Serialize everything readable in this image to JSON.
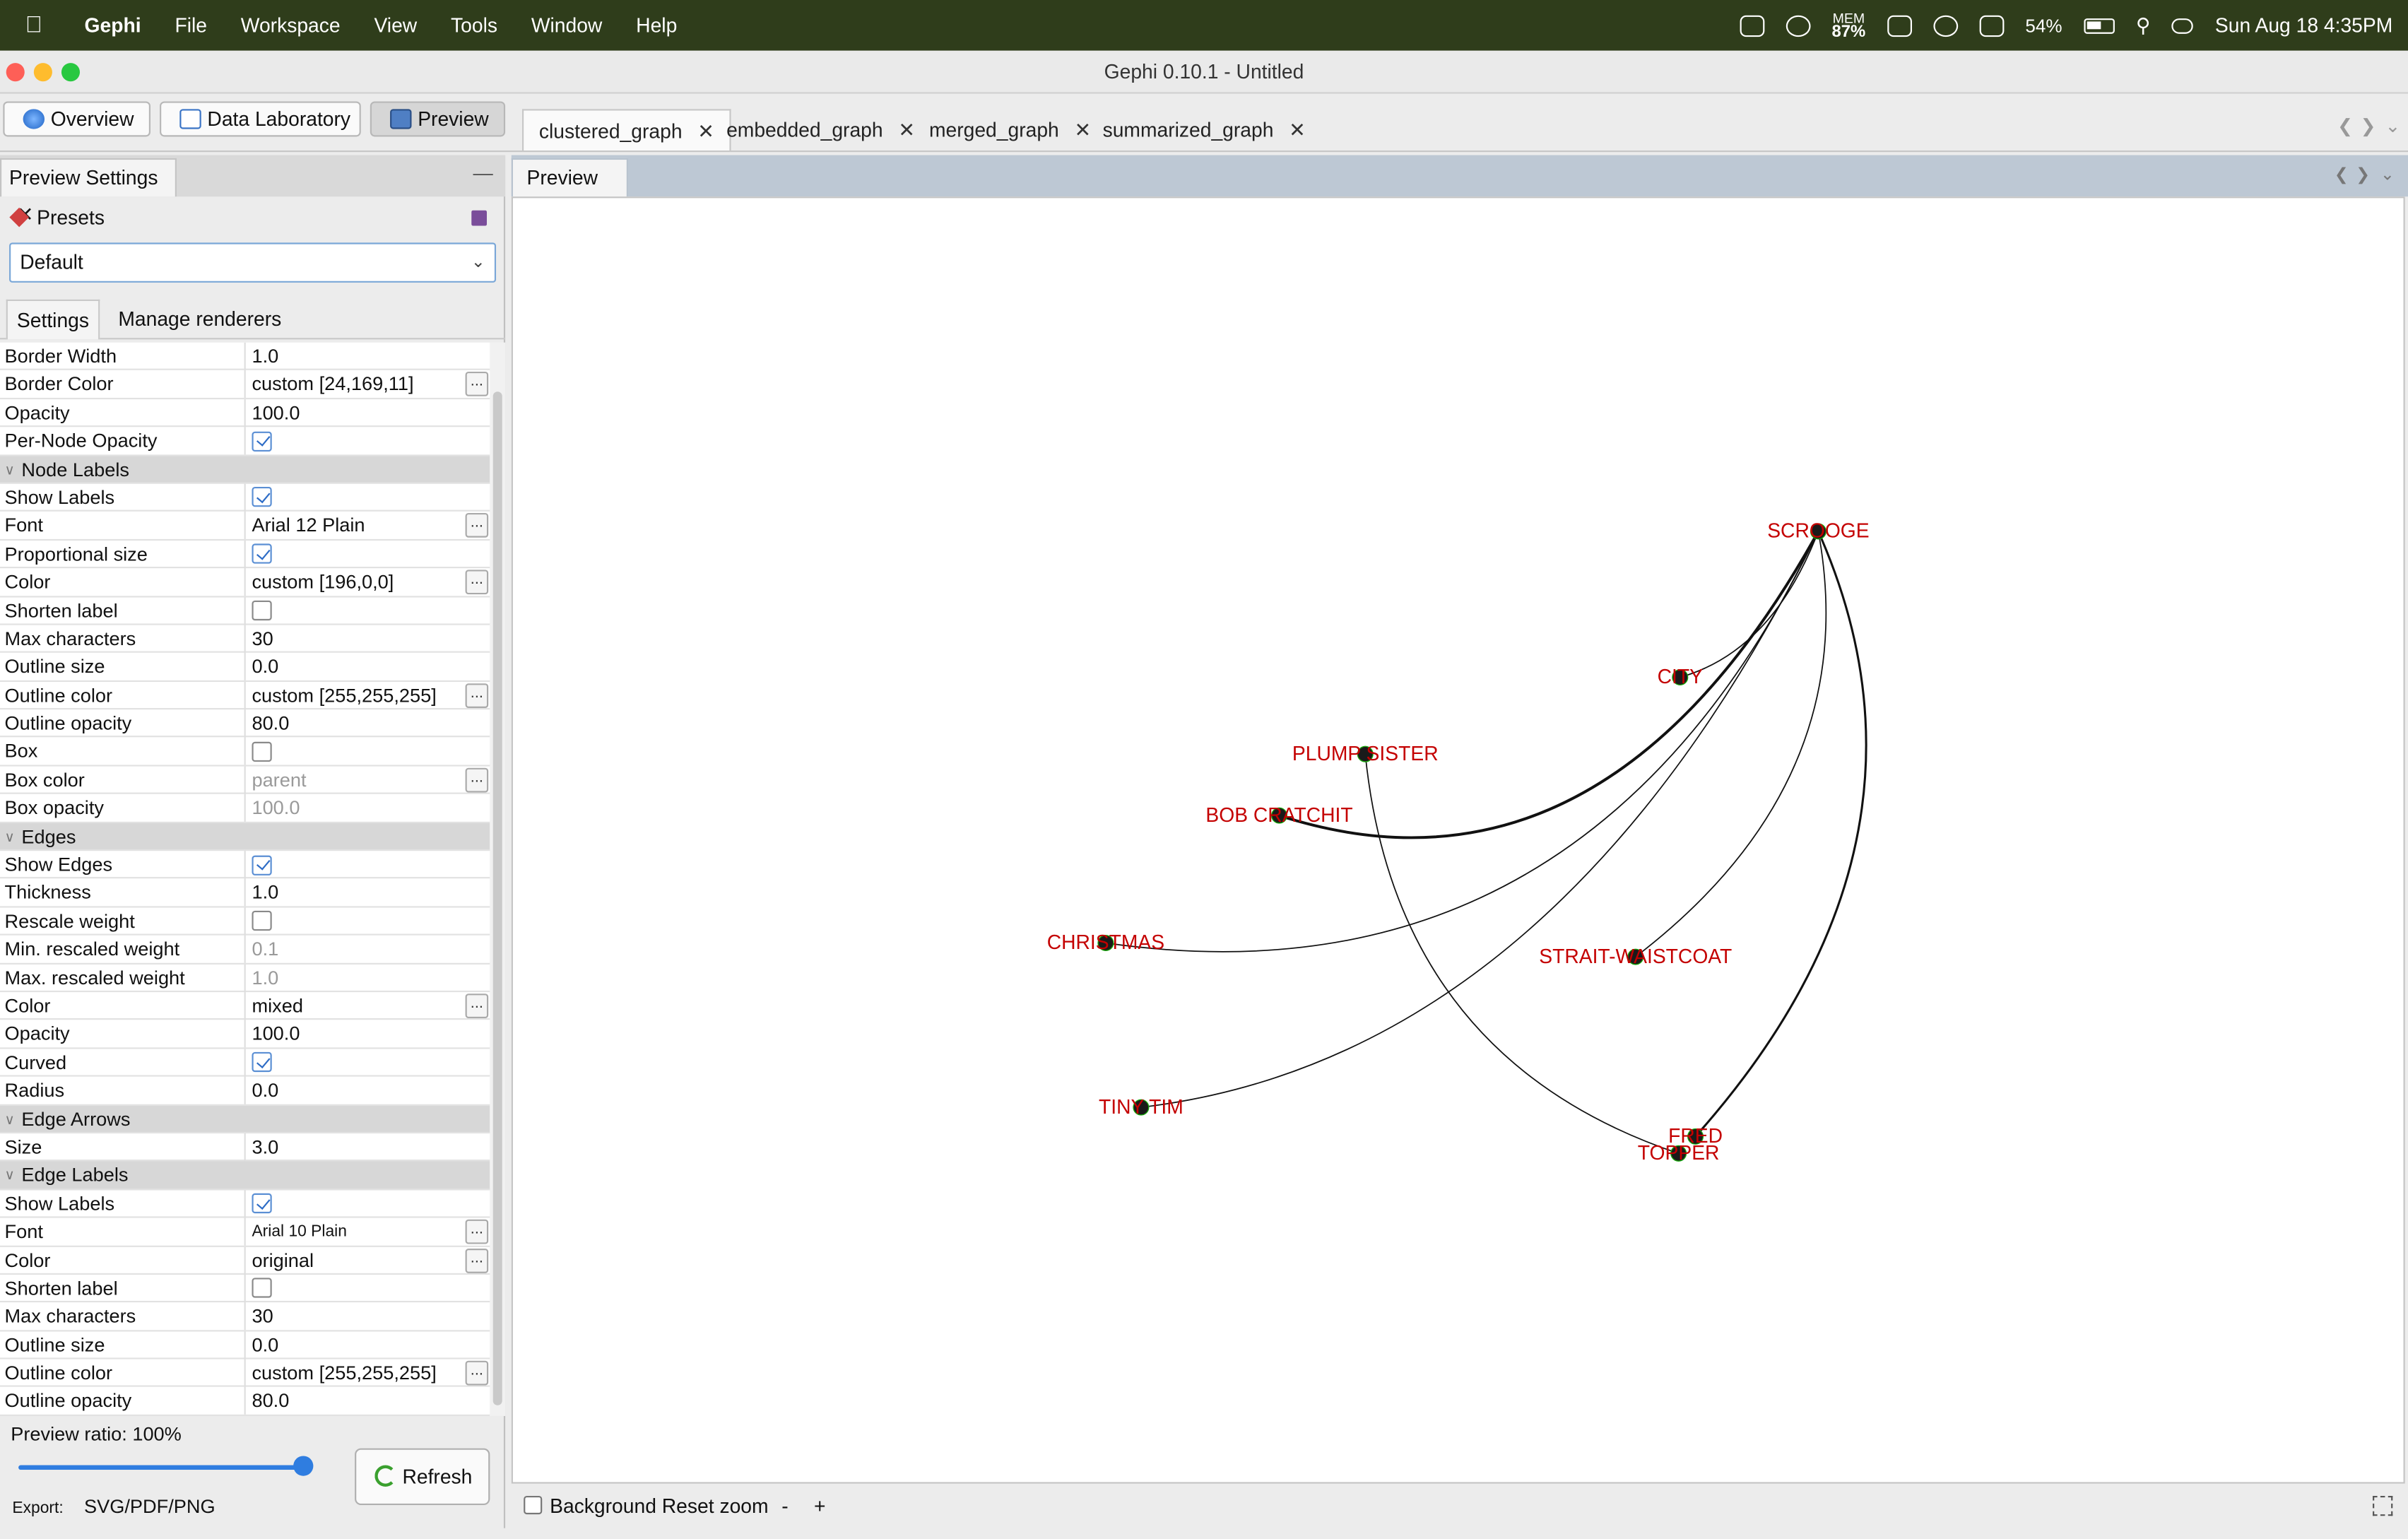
{
  "menubar": {
    "app": "Gephi",
    "items": [
      "File",
      "Workspace",
      "View",
      "Tools",
      "Window",
      "Help"
    ],
    "mem_label": "MEM",
    "mem_value": "87%",
    "battery": "54%",
    "clock": "Sun Aug 18  4:35PM"
  },
  "window": {
    "title": "Gephi 0.10.1 - Untitled"
  },
  "modes": [
    "Overview",
    "Data Laboratory",
    "Preview"
  ],
  "doc_tabs": [
    "clustered_graph",
    "embedded_graph",
    "merged_graph",
    "summarized_graph"
  ],
  "left_panel": {
    "tab": "Preview Settings",
    "presets_label": "Presets",
    "preset_value": "Default",
    "subtabs": [
      "Settings",
      "Manage renderers"
    ],
    "rows": [
      {
        "name": "Border Width",
        "value": "1.0"
      },
      {
        "name": "Border Color",
        "value": "custom [24,169,11]",
        "ell": true
      },
      {
        "name": "Opacity",
        "value": "100.0"
      },
      {
        "name": "Per-Node Opacity",
        "check": true
      },
      {
        "section": "Node Labels"
      },
      {
        "name": "Show Labels",
        "check": true
      },
      {
        "name": "Font",
        "value": "Arial 12 Plain",
        "ell": true
      },
      {
        "name": "Proportional size",
        "check": true
      },
      {
        "name": "Color",
        "value": "custom [196,0,0]",
        "ell": true
      },
      {
        "name": "Shorten label",
        "check": false
      },
      {
        "name": "Max characters",
        "value": "30"
      },
      {
        "name": "Outline size",
        "value": "0.0"
      },
      {
        "name": "Outline color",
        "value": "custom [255,255,255]",
        "ell": true
      },
      {
        "name": "Outline opacity",
        "value": "80.0"
      },
      {
        "name": "Box",
        "check": false
      },
      {
        "name": "Box color",
        "value": "parent",
        "ell": true,
        "dim": true
      },
      {
        "name": "Box opacity",
        "value": "100.0",
        "dim": true
      },
      {
        "section": "Edges"
      },
      {
        "name": "Show Edges",
        "check": true
      },
      {
        "name": "Thickness",
        "value": "1.0"
      },
      {
        "name": "Rescale weight",
        "check": false
      },
      {
        "name": "Min. rescaled weight",
        "value": "0.1",
        "dim": true
      },
      {
        "name": "Max. rescaled weight",
        "value": "1.0",
        "dim": true
      },
      {
        "name": "Color",
        "value": "mixed",
        "ell": true
      },
      {
        "name": "Opacity",
        "value": "100.0"
      },
      {
        "name": "Curved",
        "check": true
      },
      {
        "name": "Radius",
        "value": "0.0"
      },
      {
        "section": "Edge Arrows"
      },
      {
        "name": "Size",
        "value": "3.0"
      },
      {
        "section": "Edge Labels"
      },
      {
        "name": "Show Labels",
        "check": true
      },
      {
        "name": "Font",
        "value": "Arial 10 Plain",
        "ell": true,
        "small": true
      },
      {
        "name": "Color",
        "value": "original",
        "ell": true
      },
      {
        "name": "Shorten label",
        "check": false
      },
      {
        "name": "Max characters",
        "value": "30"
      },
      {
        "name": "Outline size",
        "value": "0.0"
      },
      {
        "name": "Outline color",
        "value": "custom [255,255,255]",
        "ell": true
      },
      {
        "name": "Outline opacity",
        "value": "80.0"
      }
    ],
    "preview_ratio": "Preview ratio: 100%",
    "preview_ratio_value": 1.0,
    "refresh_label": "Refresh",
    "export_label": "Export:",
    "export_formats": "SVG/PDF/PNG"
  },
  "preview": {
    "tab": "Preview",
    "background_label": "Background",
    "reset_zoom_label": "Reset zoom",
    "zoom_out_label": "-",
    "zoom_in_label": "+"
  },
  "graph": {
    "label_color": "#c40000",
    "node_color": "#1a1a1a",
    "nodes": [
      "SCROOGE",
      "CITY",
      "PLUMP SISTER",
      "BOB CRATCHIT",
      "CHRISTMAS",
      "STRAIT-WAISTCOAT",
      "TINY TIM",
      "FRED",
      "TOPPER"
    ]
  }
}
